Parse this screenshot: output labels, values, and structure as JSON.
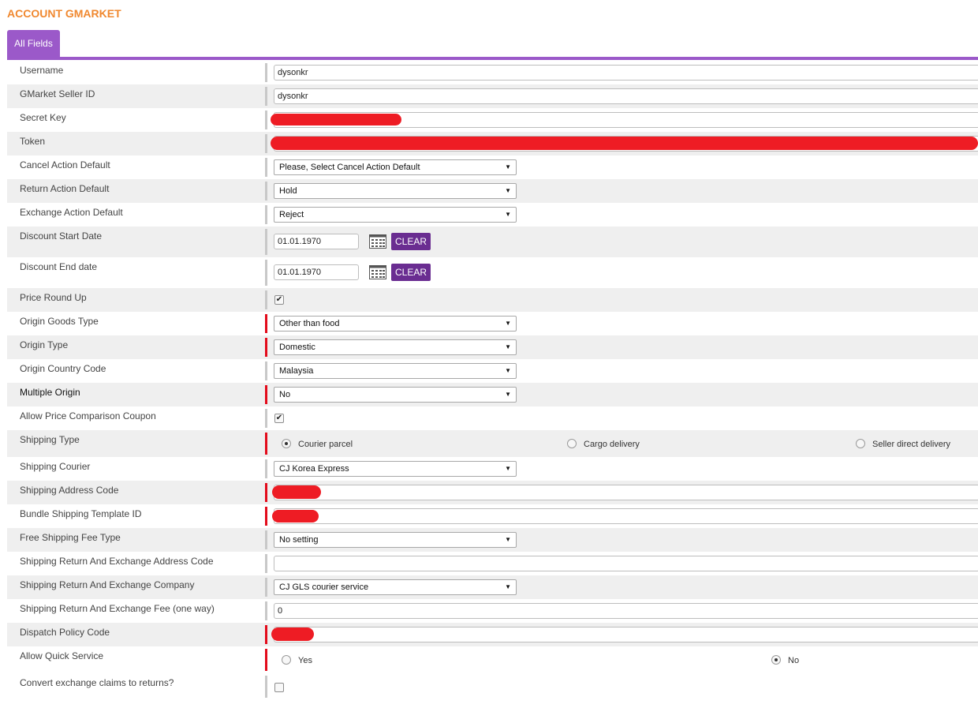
{
  "page": {
    "title": "ACCOUNT GMARKET"
  },
  "tabs": [
    {
      "label": "All Fields",
      "active": true
    }
  ],
  "fields": {
    "username": {
      "label": "Username",
      "value": "dysonkr"
    },
    "seller_id": {
      "label": "GMarket Seller ID",
      "value": "dysonkr"
    },
    "secret_key": {
      "label": "Secret Key",
      "value": ""
    },
    "token": {
      "label": "Token",
      "value": ""
    },
    "cancel_action": {
      "label": "Cancel Action Default",
      "value": "Please, Select Cancel Action Default"
    },
    "return_action": {
      "label": "Return Action Default",
      "value": "Hold"
    },
    "exchange_action": {
      "label": "Exchange Action Default",
      "value": "Reject"
    },
    "discount_start": {
      "label": "Discount Start Date",
      "value": "01.01.1970",
      "clear_label": "CLEAR"
    },
    "discount_end": {
      "label": "Discount End date",
      "value": "01.01.1970",
      "clear_label": "CLEAR"
    },
    "price_round_up": {
      "label": "Price Round Up",
      "checked": true
    },
    "origin_goods_type": {
      "label": "Origin Goods Type",
      "value": "Other than food"
    },
    "origin_type": {
      "label": "Origin Type",
      "value": "Domestic"
    },
    "origin_country": {
      "label": "Origin Country Code",
      "value": "Malaysia"
    },
    "multiple_origin": {
      "label": "Multiple Origin",
      "value": "No"
    },
    "price_coupon": {
      "label": "Allow Price Comparison Coupon",
      "checked": true
    },
    "shipping_type": {
      "label": "Shipping Type",
      "options": [
        "Courier parcel",
        "Cargo delivery",
        "Seller direct delivery"
      ],
      "selected": "Courier parcel"
    },
    "shipping_courier": {
      "label": "Shipping Courier",
      "value": "CJ Korea Express"
    },
    "shipping_address_code": {
      "label": "Shipping Address Code",
      "value": ""
    },
    "bundle_template": {
      "label": "Bundle Shipping Template ID",
      "value": ""
    },
    "free_shipping": {
      "label": "Free Shipping Fee Type",
      "value": "No setting"
    },
    "return_address_code": {
      "label": "Shipping Return And Exchange Address Code",
      "value": ""
    },
    "return_company": {
      "label": "Shipping Return And Exchange Company",
      "value": "CJ GLS courier service"
    },
    "return_fee": {
      "label": "Shipping Return And Exchange Fee (one way)",
      "value": "0"
    },
    "dispatch_policy": {
      "label": "Dispatch Policy Code",
      "value": ""
    },
    "quick_service": {
      "label": "Allow Quick Service",
      "options": [
        "Yes",
        "No"
      ],
      "selected": "No"
    },
    "convert_claims": {
      "label": "Convert exchange claims to returns?",
      "checked": false
    }
  },
  "icons": {
    "calendar": "calendar-icon",
    "dropdown": "chevron-down-icon"
  },
  "colors": {
    "title": "#f0882f",
    "tab": "#9b59c9",
    "button": "#6a2d91",
    "required": "#e30b1b",
    "redaction": "#ee1c24"
  }
}
